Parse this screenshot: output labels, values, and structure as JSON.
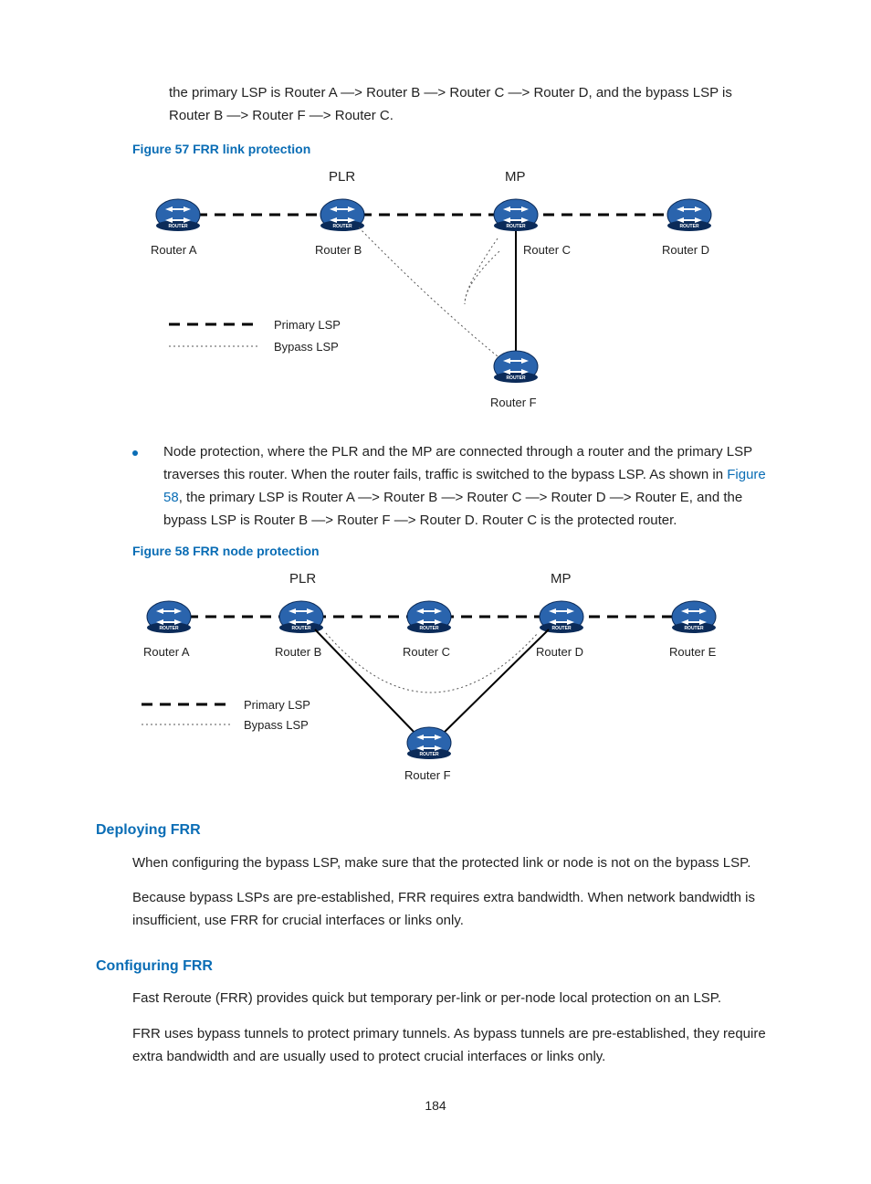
{
  "intro_text": "the primary LSP is Router A —> Router B —> Router C —> Router D, and the bypass LSP is Router B —> Router F —> Router C.",
  "fig57_caption": "Figure 57 FRR link protection",
  "fig58_caption": "Figure 58 FRR node protection",
  "bullet_text_part1": "Node protection, where the PLR and the MP are connected through a router and the primary LSP traverses this router. When the router fails, traffic is switched to the bypass LSP. As shown in ",
  "bullet_link": "Figure 58",
  "bullet_text_part2": ", the primary LSP is Router A —> Router B —> Router C —> Router D —> Router E, and the bypass LSP is Router B —> Router F —> Router D. Router C is the protected router.",
  "deploy_heading": "Deploying FRR",
  "deploy_p1": "When configuring the bypass LSP, make sure that the protected link or node is not on the bypass LSP.",
  "deploy_p2": "Because bypass LSPs are pre-established, FRR requires extra bandwidth. When network bandwidth is insufficient, use FRR for crucial interfaces or links only.",
  "config_heading": "Configuring FRR",
  "config_p1": "Fast Reroute (FRR) provides quick but temporary per-link or per-node local protection on an LSP.",
  "config_p2": "FRR uses bypass tunnels to protect primary tunnels. As bypass tunnels are pre-established, they require extra bandwidth and are usually used to protect crucial interfaces or links only.",
  "page_number": "184",
  "labels": {
    "plr": "PLR",
    "mp": "MP",
    "routerA": "Router A",
    "routerB": "Router B",
    "routerC": "Router C",
    "routerD": "Router D",
    "routerE": "Router E",
    "routerF": "Router F",
    "primary": "Primary LSP",
    "bypass": "Bypass LSP"
  }
}
